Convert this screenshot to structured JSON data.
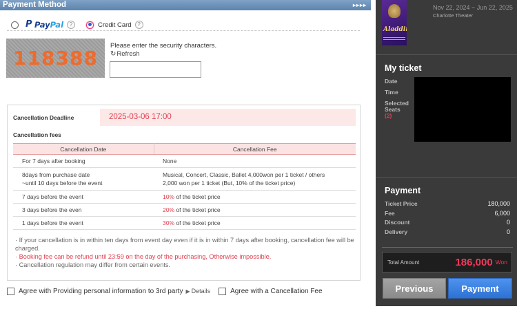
{
  "payment_method": {
    "header": "Payment Method",
    "arrows": "▸▸▸▸",
    "paypal": {
      "word1": "Pay",
      "word2": "Pal",
      "help": "?"
    },
    "credit_card": {
      "label": "Credit Card",
      "help": "?",
      "selected": true
    },
    "captcha_code": "118388",
    "security_prompt": "Please enter the security characters.",
    "refresh_label": "Refresh",
    "security_input_value": ""
  },
  "cancellation": {
    "deadline_label": "Cancellation Deadline",
    "deadline_value": "2025-03-06 17:00",
    "fees_label": "Cancellation fees",
    "columns": [
      "Cancellation Date",
      "Cancellation Fee"
    ],
    "rows": [
      {
        "date": "For 7 days after booking",
        "fee": "None"
      },
      {
        "date_line1": "8days from purchase date",
        "date_line2": "~until 10 days before the event",
        "fee_line1": "Musical, Concert, Classic, Ballet 4,000won per 1 ticket / others",
        "fee_line2": "2,000 won per 1 ticket (But, 10% of the ticket price)"
      },
      {
        "date": "7 days before the event",
        "fee_pct": "10%",
        "fee_rest": " of the ticket price"
      },
      {
        "date": "3 days before the even",
        "fee_pct": "20%",
        "fee_rest": " of the ticket price"
      },
      {
        "date": "1 days before the event",
        "fee_pct": "30%",
        "fee_rest": " of the ticket price"
      }
    ],
    "notes": [
      "· If your cancellation is in within ten days from event day even if it is in within 7 days after booking, cancellation fee will be charged.",
      "· Booking fee can be refund until 23:59 on the day of the purchasing, Otherwise impossible.",
      "· Cancellation regulation may differ from certain events."
    ]
  },
  "agreements": {
    "third_party": "Agree with Providing personal information to 3rd party",
    "details": "Details",
    "cancellation_fee": "Agree with a Cancellation Fee"
  },
  "sidebar": {
    "poster_title": "Aladdin",
    "show_dates": "Nov 22, 2024 ~ Jun 22, 2025",
    "venue": "Charlotte Theater",
    "my_ticket_title": "My ticket",
    "labels": {
      "date": "Date",
      "time": "Time",
      "seats_line1": "Selected",
      "seats_line2": "Seats",
      "seat_count": "(2)"
    },
    "payment_title": "Payment",
    "payment_rows": [
      {
        "label": "Ticket Price",
        "value": "180,000"
      },
      {
        "label": "Fee",
        "value": "6,000"
      },
      {
        "label": "Discount",
        "value": "0"
      },
      {
        "label": "Delivery",
        "value": "0"
      }
    ],
    "total_label": "Total Amount",
    "total_amount": "186,000",
    "currency": "Won",
    "previous_button": "Previous",
    "payment_button": "Payment"
  },
  "colors": {
    "accent_red": "#e04050",
    "pay_blue": "#2d72d4",
    "header_blue": "#6b90b8",
    "sidebar_bg": "#3a3a3a"
  }
}
